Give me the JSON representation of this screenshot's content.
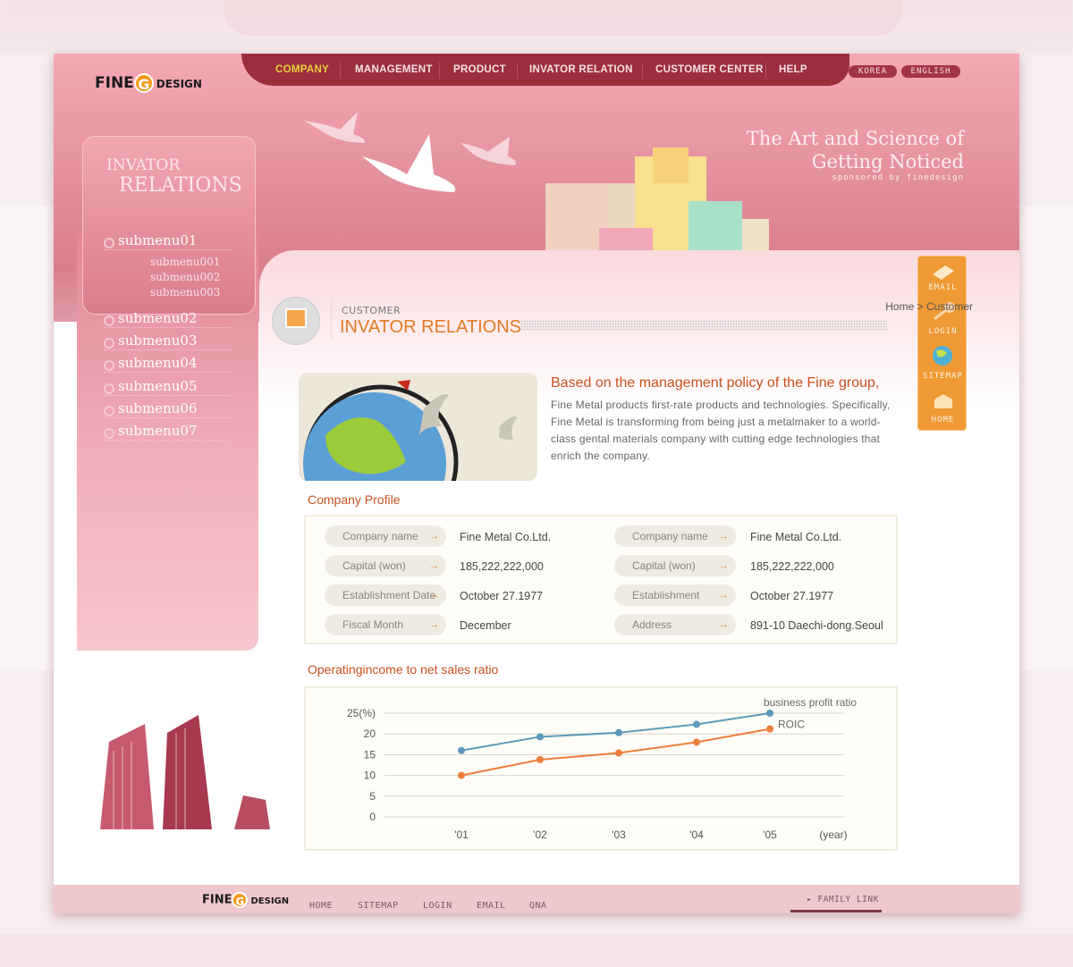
{
  "brand": {
    "logo_fine": "FINE",
    "logo_g": "G",
    "logo_design": "DESIGN"
  },
  "nav": {
    "items": [
      "COMPANY",
      "MANAGEMENT",
      "PRODUCT",
      "INVATOR RELATION",
      "CUSTOMER CENTER",
      "HELP"
    ],
    "active": "COMPANY",
    "languages": [
      "KOREA",
      "ENGLISH"
    ]
  },
  "hero": {
    "line1": "The Art and Science of",
    "line2": "Getting Noticed",
    "line3": "sponsored by finedesign"
  },
  "sidebar": {
    "title_line1": "INVATOR",
    "title_line2": "RELATIONS",
    "menu": [
      "submenu01",
      "submenu02",
      "submenu03",
      "submenu04",
      "submenu05",
      "submenu06",
      "submenu07"
    ],
    "submenu01_children": [
      "submenu001",
      "submenu002",
      "submenu003"
    ]
  },
  "quick_menu": [
    {
      "label": "EMAIL",
      "icon": "envelope-icon"
    },
    {
      "label": "LOGIN",
      "icon": "key-icon"
    },
    {
      "label": "SITEMAP",
      "icon": "globe-icon"
    },
    {
      "label": "HOME",
      "icon": "house-icon"
    }
  ],
  "page": {
    "category": "CUSTOMER",
    "title": "INVATOR RELATIONS",
    "breadcrumb": [
      "Home",
      "Customer"
    ],
    "breadcrumb_sep": ">"
  },
  "intro": {
    "heading": "Based on the management policy of the Fine group,",
    "body": "Fine Metal products first-rate products and technologies. Specifically, Fine Metal is  transforming from being just a  metalmaker to a  world-class gental materials company with cutting edge technologies that enrich the company."
  },
  "profile": {
    "title": "Company Profile",
    "left": [
      {
        "label": "Company name",
        "value": "Fine Metal Co.Ltd."
      },
      {
        "label": "Capital (won)",
        "value": "185,222,222,000"
      },
      {
        "label": "Establishment Date",
        "value": "October 27.1977"
      },
      {
        "label": "Fiscal Month",
        "value": "December"
      }
    ],
    "right": [
      {
        "label": "Company name",
        "value": "Fine Metal Co.Ltd."
      },
      {
        "label": "Capital (won)",
        "value": "185,222,222,000"
      },
      {
        "label": "Establishment",
        "value": "October 27.1977"
      },
      {
        "label": "Address",
        "value": "891-10 Daechi-dong.Seoul"
      }
    ]
  },
  "chart_section_title": "Operatingincome to net sales ratio",
  "chart_data": {
    "type": "line",
    "categories": [
      "'01",
      "'02",
      "'03",
      "'04",
      "'05"
    ],
    "xlabel": "(year)",
    "y_ticks": [
      "0",
      "5",
      "10",
      "15",
      "20",
      "25(%)"
    ],
    "ylim": [
      0,
      25
    ],
    "grid": true,
    "series": [
      {
        "name": "business profit ratio",
        "values": [
          16,
          19.3,
          20.3,
          22.3,
          25
        ],
        "color": "#5b9abb"
      },
      {
        "name": "ROIC",
        "values": [
          10,
          13.8,
          15.4,
          18,
          21.2
        ],
        "color": "#ec7d3c"
      }
    ]
  },
  "footer": {
    "links": [
      "HOME",
      "SITEMAP",
      "LOGIN",
      "EMAIL",
      "QNA"
    ],
    "family_link": "FAMILY LINK"
  },
  "colors": {
    "nav": "#9c2d3d",
    "accent": "#c9501e",
    "active_nav": "#e8d23a",
    "quick_menu": "#ef9a35"
  }
}
